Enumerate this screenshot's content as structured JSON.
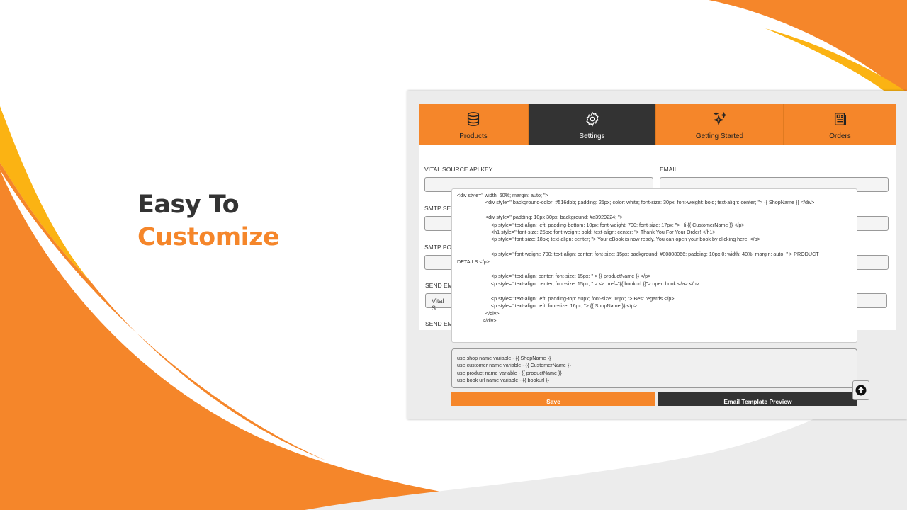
{
  "headline": {
    "line1": "Easy To",
    "line2": "Customize"
  },
  "colors": {
    "accent": "#f5862a",
    "dark": "#333333",
    "yellow": "#fbb313"
  },
  "tabs": [
    {
      "label": "Products",
      "icon": "database-icon"
    },
    {
      "label": "Settings",
      "icon": "gear-icon",
      "active": true
    },
    {
      "label": "Getting Started",
      "icon": "sparkles-icon"
    },
    {
      "label": "Orders",
      "icon": "newspaper-icon"
    }
  ],
  "form": {
    "api_key_label": "VITAL SOURCE API KEY",
    "email_label": "EMAIL",
    "smtp_server_label": "SMTP SE",
    "smtp_port_label": "SMTP PO",
    "send_email_label": "SEND EM",
    "send_email_value": "Vital S",
    "send_email2_label": "SEND EM"
  },
  "template_code": "<div style=\" width: 60%; margin: auto; \">\n                    <div style=\" background-color: #516dbb; padding: 25px; color: white; font-size: 30px; font-weight: bold; text-align: center; \"> {{ ShopName }} </div>\n\n                    <div style=\" padding: 10px 30px; background: #a3929224; \">\n                        <p style=\" text-align: left; padding-bottom: 10px; font-weight: 700; font-size: 17px; \"> Hi {{ CustomerName }} </p>\n                        <h1 style=\" font-size: 25px; font-weight: bold; text-align: center; \"> Thank You For Your Order! </h1>\n                        <p style=\" font-size: 18px; text-align: center; \"> Your eBook is now ready. You can open your book by clicking here. </p>\n\n                        <p style=\" font-weight: 700; text-align: center; font-size: 15px; background: #80808066; padding: 10px 0; width: 40%; margin: auto; \" > PRODUCT\nDETAILS </p>\n\n                        <p style=\" text-align: center; font-size: 15px; \" > {{ productName }} </p>\n                        <p style=\" text-align: center; font-size: 15px; \" > <a href=\"{{ bookurl }}\"> open book </a> </p>\n\n                        <p style=\" text-align: left; padding-top: 50px; font-size: 16px; \"> Best regards </p>\n                        <p style=\" text-align: left; font-size: 16px; \"> {{ ShopName }} </p>\n                    </div>\n                  </div>",
  "variables": [
    "use shop name variable - {{ ShopName }}",
    "use customer name variable - {{ CustomerName }}",
    "use product name variable - {{ productName }}",
    "use book url name variable - {{ bookurl }}"
  ],
  "buttons": {
    "save": "Save",
    "preview": "Email Template Preview"
  }
}
